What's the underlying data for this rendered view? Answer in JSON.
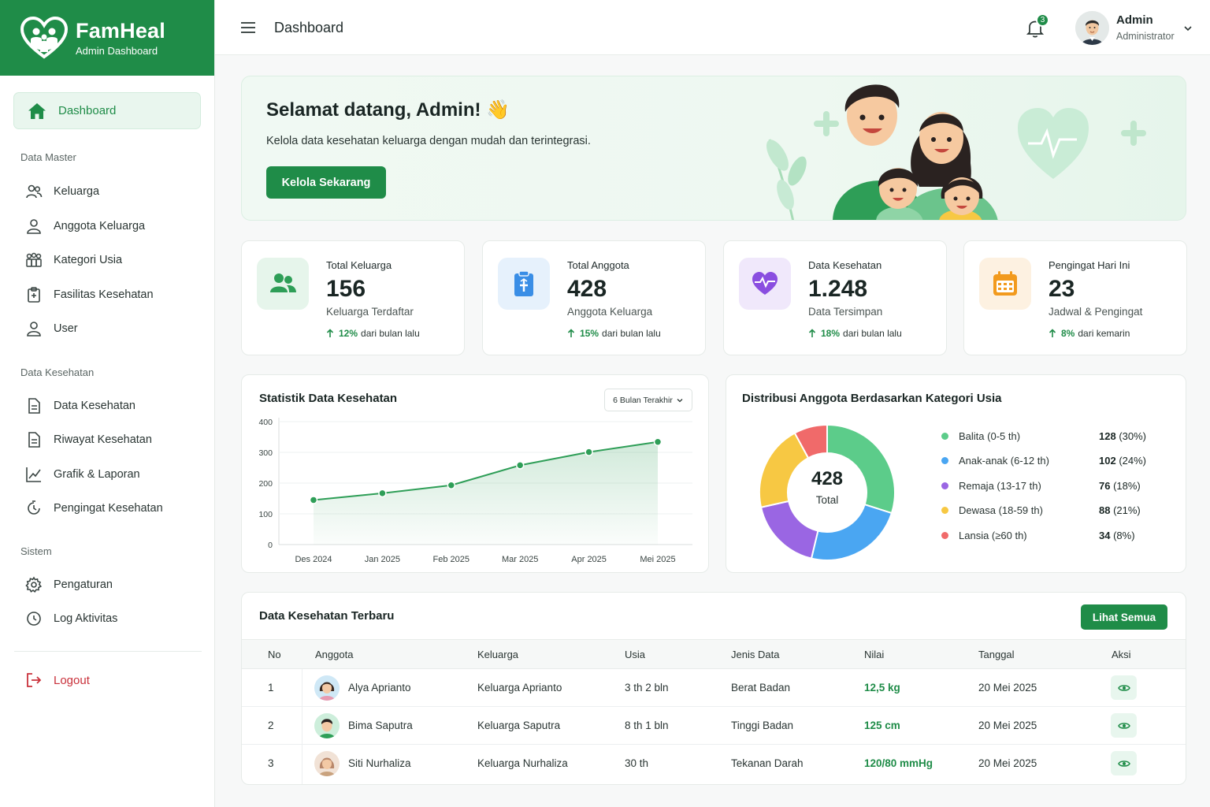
{
  "brand": {
    "title": "FamHeal",
    "subtitle": "Admin Dashboard"
  },
  "sidebar": {
    "active": {
      "label": "Dashboard",
      "icon": "home-icon"
    },
    "sections": [
      {
        "title": "Data Master",
        "items": [
          {
            "label": "Keluarga",
            "icon": "users-icon"
          },
          {
            "label": "Anggota Keluarga",
            "icon": "user-icon"
          },
          {
            "label": "Kategori Usia",
            "icon": "group-icon"
          },
          {
            "label": "Fasilitas Kesehatan",
            "icon": "clipboard-plus-icon"
          },
          {
            "label": "User",
            "icon": "user-icon"
          }
        ]
      },
      {
        "title": "Data Kesehatan",
        "items": [
          {
            "label": "Data Kesehatan",
            "icon": "document-icon"
          },
          {
            "label": "Riwayat Kesehatan",
            "icon": "document-icon"
          },
          {
            "label": "Grafik & Laporan",
            "icon": "chart-line-icon"
          },
          {
            "label": "Pengingat Kesehatan",
            "icon": "clock-icon"
          }
        ]
      },
      {
        "title": "Sistem",
        "items": [
          {
            "label": "Pengaturan",
            "icon": "gear-icon"
          },
          {
            "label": "Log Aktivitas",
            "icon": "clock-icon"
          }
        ]
      }
    ],
    "logout": "Logout"
  },
  "topbar": {
    "title": "Dashboard",
    "notifications": "3",
    "user_name": "Admin",
    "user_role": "Administrator"
  },
  "hero": {
    "title": "Selamat datang, Admin! 👋",
    "text": "Kelola data kesehatan keluarga dengan mudah dan terintegrasi.",
    "button": "Kelola Sekarang"
  },
  "stats": [
    {
      "label": "Total Keluarga",
      "value": "156",
      "sub": "Keluarga Terdaftar",
      "pct": "12%",
      "trend": "dari bulan lalu",
      "icon": "users-icon",
      "color": "#2e9e57",
      "bg": "#e6f5eb"
    },
    {
      "label": "Total Anggota",
      "value": "428",
      "sub": "Anggota Keluarga",
      "pct": "15%",
      "trend": "dari bulan lalu",
      "icon": "clipboard-icon",
      "color": "#3a8ee6",
      "bg": "#e6f1fc"
    },
    {
      "label": "Data Kesehatan",
      "value": "1.248",
      "sub": "Data Tersimpan",
      "pct": "18%",
      "trend": "dari bulan lalu",
      "icon": "heart-pulse-icon",
      "color": "#8a4ee0",
      "bg": "#f0e8fb"
    },
    {
      "label": "Pengingat Hari Ini",
      "value": "23",
      "sub": "Jadwal & Pengingat",
      "pct": "8%",
      "trend": "dari kemarin",
      "icon": "calendar-icon",
      "color": "#f29a1d",
      "bg": "#fdf1e1"
    }
  ],
  "line_chart": {
    "title": "Statistik Data Kesehatan",
    "dropdown": "6 Bulan Terakhir",
    "yticks": [
      "0",
      "100",
      "200",
      "300",
      "400"
    ]
  },
  "donut": {
    "title": "Distribusi Anggota Berdasarkan Kategori Usia",
    "total": "428",
    "total_label": "Total"
  },
  "chart_data": [
    {
      "type": "area",
      "title": "Statistik Data Kesehatan",
      "categories": [
        "Des 2024",
        "Jan 2025",
        "Feb 2025",
        "Mar 2025",
        "Apr 2025",
        "Mei 2025"
      ],
      "values": [
        145,
        167,
        193,
        258,
        301,
        334
      ],
      "ylim": [
        0,
        400
      ],
      "grid": true,
      "color": "#2e9e57"
    },
    {
      "type": "pie",
      "title": "Distribusi Anggota Berdasarkan Kategori Usia",
      "categories": [
        "Balita (0-5 th)",
        "Anak-anak (6-12 th)",
        "Remaja (13-17 th)",
        "Dewasa (18-59 th)",
        "Lansia (≥60 th)"
      ],
      "values": [
        128,
        102,
        76,
        88,
        34
      ],
      "labels": [
        "128 (30%)",
        "102 (24%)",
        "76 (18%)",
        "88 (21%)",
        "34 (8%)"
      ],
      "colors": [
        "#5ccc8a",
        "#4aa6f2",
        "#9a66e3",
        "#f7c843",
        "#f06a6a"
      ],
      "legend": "right"
    }
  ],
  "table": {
    "title": "Data Kesehatan Terbaru",
    "button": "Lihat Semua",
    "headers": [
      "No",
      "Anggota",
      "Keluarga",
      "Usia",
      "Jenis Data",
      "Nilai",
      "Tanggal",
      "Aksi"
    ],
    "rows": [
      {
        "no": "1",
        "anggota": "Alya Aprianto",
        "keluarga": "Keluarga Aprianto",
        "usia": "3 th 2 bln",
        "jenis": "Berat Badan",
        "nilai": "12,5 kg",
        "tanggal": "20 Mei 2025"
      },
      {
        "no": "2",
        "anggota": "Bima Saputra",
        "keluarga": "Keluarga Saputra",
        "usia": "8 th 1 bln",
        "jenis": "Tinggi Badan",
        "nilai": "125 cm",
        "tanggal": "20 Mei 2025"
      },
      {
        "no": "3",
        "anggota": "Siti Nurhaliza",
        "keluarga": "Keluarga Nurhaliza",
        "usia": "30 th",
        "jenis": "Tekanan Darah",
        "nilai": "120/80 mmHg",
        "tanggal": "20 Mei 2025"
      }
    ]
  }
}
